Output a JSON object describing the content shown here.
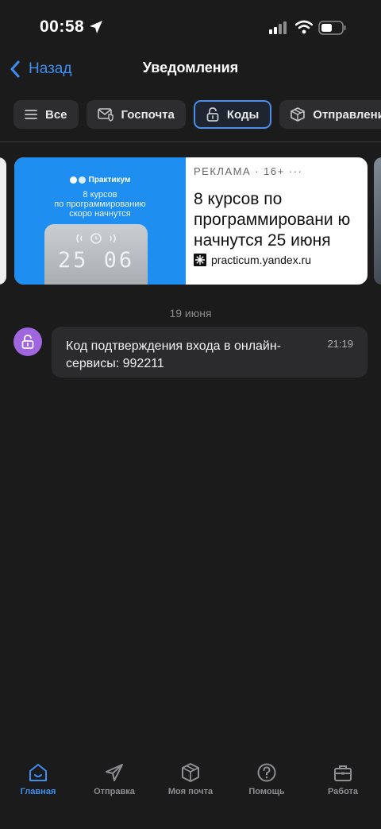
{
  "status_bar": {
    "time": "00:58"
  },
  "nav": {
    "back_label": "Назад",
    "title": "Уведомления"
  },
  "filters": [
    {
      "label": "Все",
      "icon": "list-icon",
      "active": false
    },
    {
      "label": "Госпочта",
      "icon": "envelope-shield-icon",
      "active": false
    },
    {
      "label": "Коды",
      "icon": "lock-icon",
      "active": true
    },
    {
      "label": "Отправлени",
      "icon": "box-icon",
      "active": false
    }
  ],
  "ad": {
    "brand": "Практикум",
    "image_text": "8 курсов\nпо программированию\nскоро начнутся",
    "device_digits": "25 06",
    "label": "РЕКЛАМА · 16+ ···",
    "title": "8 курсов по программировани ю начнутся 25 июня",
    "domain": "practicum.yandex.ru",
    "accent_color": "#1e8ef0"
  },
  "feed": {
    "date": "19 июня",
    "messages": [
      {
        "text": "Код подтверждения входа в онлайн-сервисы: 992211",
        "time": "21:19",
        "icon": "lock-icon",
        "avatar_color": "#a066e0"
      }
    ]
  },
  "tabbar": [
    {
      "label": "Главная",
      "icon": "home-icon",
      "active": true
    },
    {
      "label": "Отправка",
      "icon": "paper-plane-icon",
      "active": false
    },
    {
      "label": "Моя почта",
      "icon": "box-icon",
      "active": false
    },
    {
      "label": "Помощь",
      "icon": "help-icon",
      "active": false
    },
    {
      "label": "Работа",
      "icon": "briefcase-icon",
      "active": false
    }
  ],
  "colors": {
    "accent": "#3d8ef0",
    "background": "#1b1b1b",
    "card": "#2b2b2d"
  }
}
